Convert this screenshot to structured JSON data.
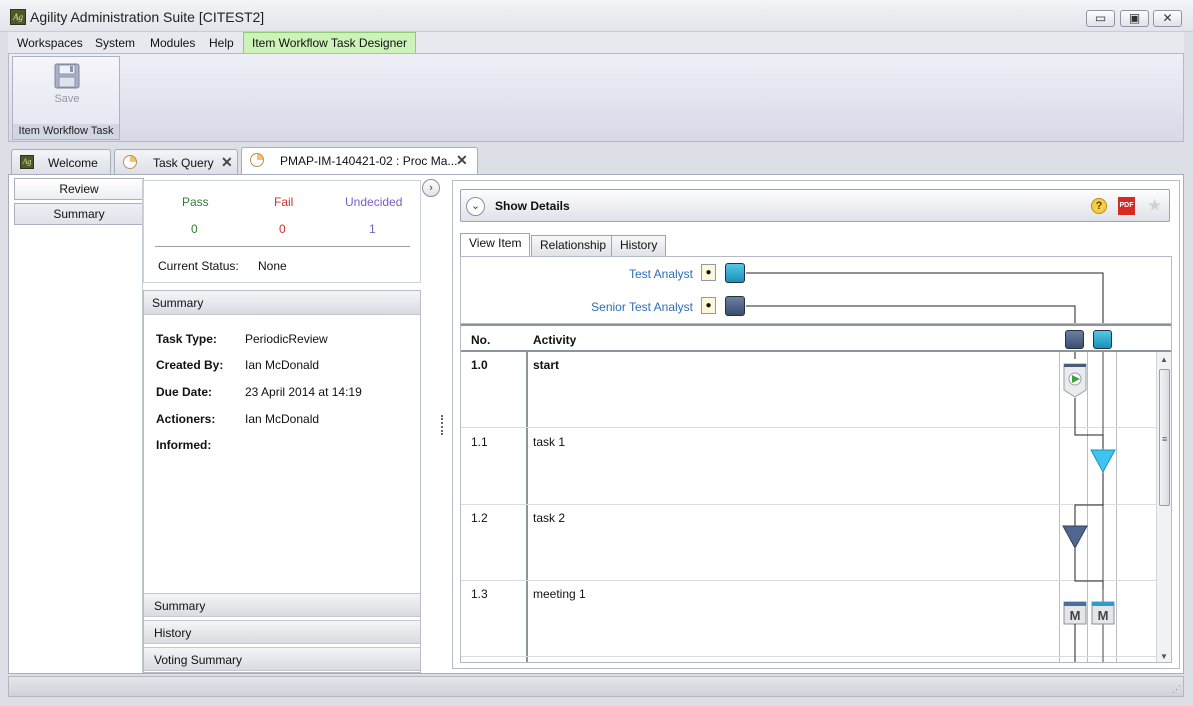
{
  "window": {
    "title": "Agility Administration Suite [CITEST2]",
    "logo": "Ag",
    "controls": {
      "minimize": "▭",
      "maximize": "▣",
      "close": "✕"
    }
  },
  "menubar": {
    "items": [
      "Workspaces",
      "System",
      "Modules",
      "Help"
    ],
    "active_context": "Item Workflow Task Designer"
  },
  "ribbon": {
    "save_label": "Save",
    "save_icon": "floppy-disk-icon",
    "group_label": "Item Workflow Task"
  },
  "doc_tabs": [
    {
      "label": "Welcome",
      "icon": "ag-logo-icon",
      "active": false,
      "closable": false
    },
    {
      "label": "Task Query",
      "icon": "pie-chart-icon",
      "active": false,
      "closable": true
    },
    {
      "label": "PMAP-IM-140421-02 : Proc Ma...",
      "icon": "pie-chart-icon",
      "active": true,
      "closable": true
    }
  ],
  "close_glyph": "✕",
  "side_tabs": [
    "Review",
    "Summary"
  ],
  "votes": {
    "pass_label": "Pass",
    "pass_value": "0",
    "fail_label": "Fail",
    "fail_value": "0",
    "undecided_label": "Undecided",
    "undecided_value": "1",
    "status_label": "Current Status:",
    "status_value": "None",
    "colors": {
      "pass": "#2e7d32",
      "fail": "#d32f2f",
      "undecided": "#7a5cc4"
    }
  },
  "summary": {
    "header": "Summary",
    "task_type_label": "Task Type:",
    "task_type_value": "PeriodicReview",
    "created_by_label": "Created By:",
    "created_by_value": "Ian McDonald",
    "due_date_label": "Due Date:",
    "due_date_value": "23 April 2014 at 14:19",
    "actioners_label": "Actioners:",
    "actioners_value": "Ian McDonald",
    "informed_label": "Informed:",
    "accordions": [
      "Summary",
      "History",
      "Voting Summary"
    ]
  },
  "item_panel": {
    "show_details_label": "Show Details",
    "tabs": [
      "View Item",
      "Relationship",
      "History"
    ],
    "active_tab": "View Item",
    "roles": [
      {
        "name": "Test Analyst",
        "color": "#1b8fb8"
      },
      {
        "name": "Senior Test Analyst",
        "color": "#3d4f70"
      }
    ],
    "grid": {
      "col_no": "No.",
      "col_activity": "Activity",
      "rows": [
        {
          "no": "1.0",
          "activity": "start",
          "shape": "start-play-icon"
        },
        {
          "no": "1.1",
          "activity": "task 1",
          "shape": "task-triangle-icon"
        },
        {
          "no": "1.2",
          "activity": "task 2",
          "shape": "task-triangle-icon"
        },
        {
          "no": "1.3",
          "activity": "meeting 1",
          "shape": "meeting-calendar-icon"
        }
      ],
      "meeting_glyph": "M"
    }
  },
  "icons": {
    "help": "?",
    "pdf": "PDF",
    "star": "★",
    "expand": "›",
    "toggle": "⌄",
    "scroll_up": "▲",
    "scroll_down": "▼",
    "scroll_grip": "≡",
    "resize_grip": "⋰"
  }
}
